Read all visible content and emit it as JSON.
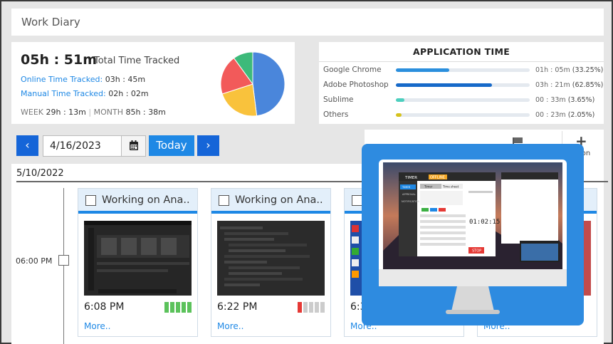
{
  "header": {
    "title": "Work Diary"
  },
  "summary": {
    "total_time": "05h : 51m",
    "total_label": "Total Time Tracked",
    "online_label": "Online Time Tracked:",
    "online_value": "03h : 45m",
    "manual_label": "Manual Time Tracked:",
    "manual_value": "02h : 02m",
    "week_label": "WEEK",
    "week_value": "29h : 13m",
    "month_label": "MONTH",
    "month_value": "85h : 38m",
    "pie": [
      {
        "label": "slice-blue",
        "value": 0.48,
        "color": "#4a86db"
      },
      {
        "label": "slice-yellow",
        "value": 0.22,
        "color": "#f9c23c"
      },
      {
        "label": "slice-red",
        "value": 0.2,
        "color": "#f25a5a"
      },
      {
        "label": "slice-green",
        "value": 0.1,
        "color": "#3dba7a"
      }
    ]
  },
  "app_time": {
    "title": "APPLICATION TIME",
    "apps": [
      {
        "name": "Google Chrome",
        "time": "01h : 05m",
        "pct": "(33.25%)",
        "fill": 0.4,
        "color": "#2b8fdd"
      },
      {
        "name": "Adobe Photoshop",
        "time": "03h : 21m",
        "pct": "(62.85%)",
        "fill": 0.72,
        "color": "#1669c9"
      },
      {
        "name": "Sublime",
        "time": "00 : 33m",
        "pct": "(3.65%)",
        "fill": 0.065,
        "color": "#4ccfbe"
      },
      {
        "name": "Others",
        "time": "00 : 23m",
        "pct": "(2.05%)",
        "fill": 0.045,
        "color": "#d6c21b"
      }
    ]
  },
  "toolbar": {
    "prev": "‹",
    "next": "›",
    "date": "4/16/2023",
    "today": "Today",
    "plus": "+",
    "plus_label": "ion"
  },
  "timeline": {
    "day": "5/10/2022",
    "hour": "06:00 PM",
    "cards": [
      {
        "title": "Working on Ana..",
        "time": "6:08 PM",
        "more": "More..",
        "activity": [
          "#5bc25b",
          "#5bc25b",
          "#5bc25b",
          "#5bc25b",
          "#5bc25b"
        ]
      },
      {
        "title": "Working on Ana..",
        "time": "6:22 PM",
        "more": "More..",
        "activity": [
          "#e53935",
          "#cccccc",
          "#cccccc",
          "#cccccc",
          "#cccccc"
        ]
      },
      {
        "title": "",
        "time": "6:3",
        "more": "More..",
        "activity": []
      },
      {
        "title": "",
        "time": "",
        "more": "More..",
        "activity": []
      }
    ]
  },
  "promo": {
    "app_timer_tab": "TIMER",
    "offline": "OFFLINE",
    "menu": [
      "TIMER",
      "APPROVAL",
      "NOTIFICATION"
    ],
    "tabs": [
      "Timer",
      "Time sheet"
    ],
    "clock": "01:02:15",
    "stop": "STOP"
  }
}
